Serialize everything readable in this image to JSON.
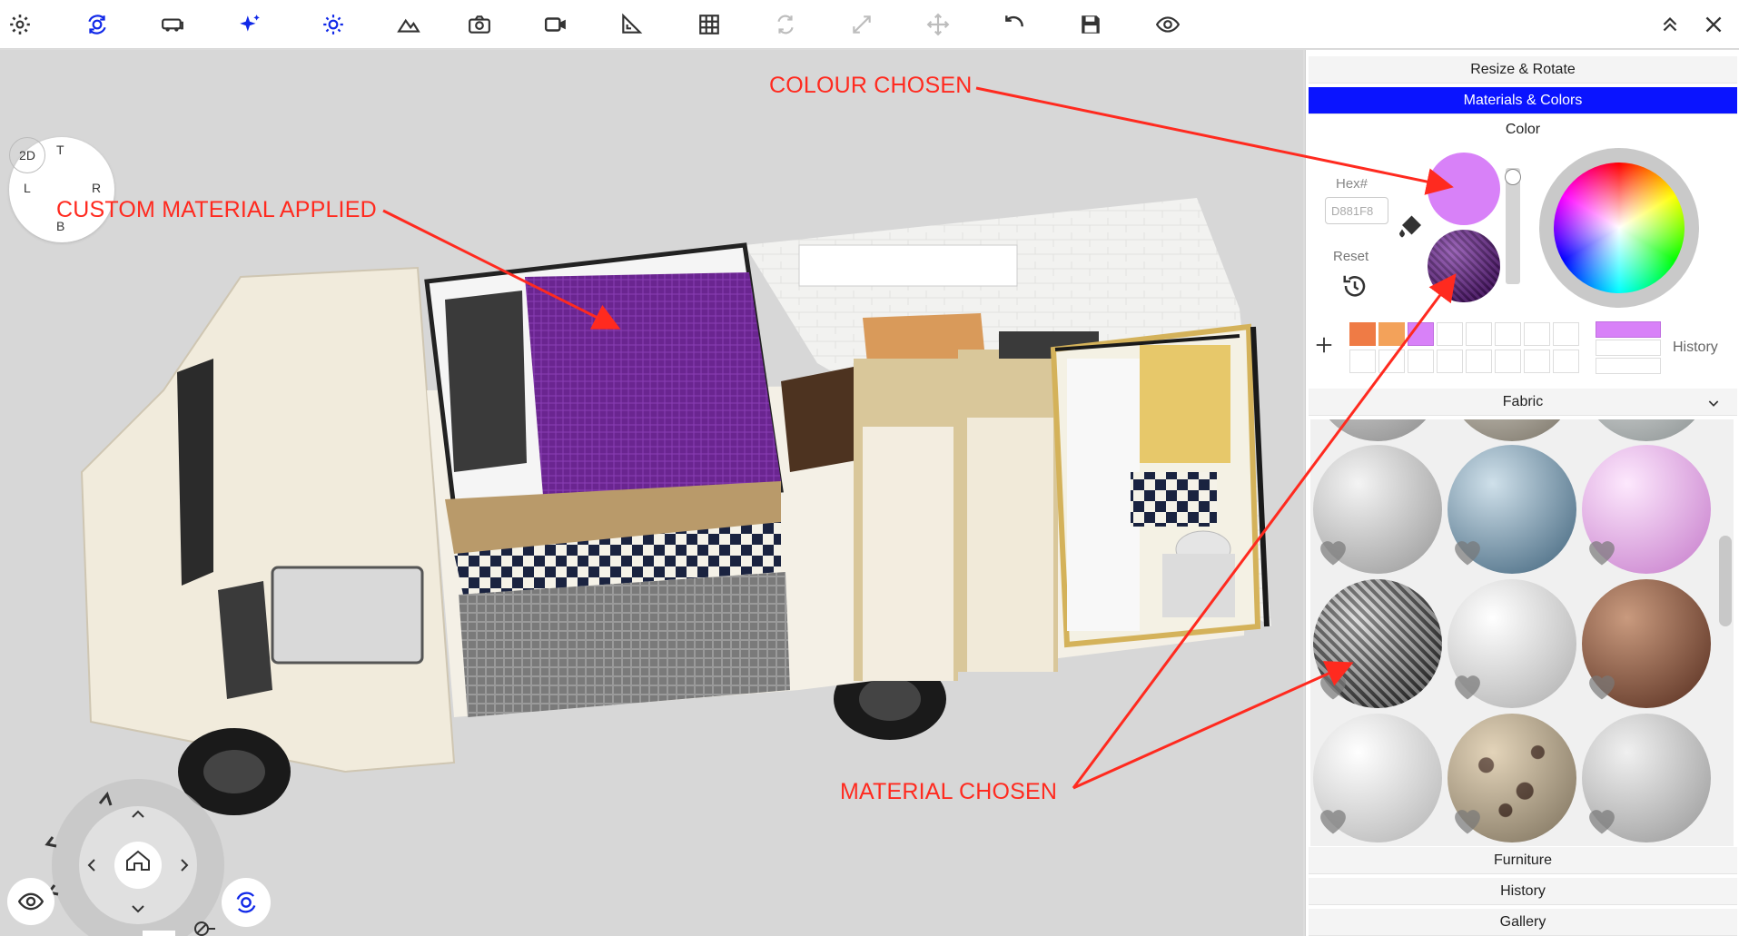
{
  "toolbar": {
    "icons": [
      "gear-icon",
      "orbit-icon",
      "van-icon",
      "sparkle-icon",
      "sun-icon",
      "mountain-icon",
      "camera-icon",
      "video-icon",
      "ruler-angle-icon",
      "grid-icon",
      "rotate-icon",
      "resize-icon",
      "move-icon",
      "undo-icon",
      "save-icon",
      "eye-icon",
      "collapse-icon",
      "close-icon"
    ]
  },
  "compass": {
    "top": "T",
    "left": "L",
    "center": "2D",
    "right": "R",
    "bottom": "B"
  },
  "annotations": {
    "colour": "COLOUR CHOSEN",
    "custom": "CUSTOM MATERIAL APPLIED",
    "material": "MATERIAL CHOSEN"
  },
  "panel": {
    "resize_rotate": "Resize & Rotate",
    "materials_colors": "Materials & Colors",
    "color": "Color",
    "hex_label": "Hex#",
    "hex_value": "D881F8",
    "reset": "Reset",
    "history_label": "History",
    "fabric": "Fabric",
    "furniture": "Furniture",
    "history": "History",
    "gallery": "Gallery"
  },
  "colors": {
    "chosen": "#d881f8",
    "accent": "#0a14ff",
    "annotation": "#ff2a1f",
    "palette": [
      "#ef7b45",
      "#f3a25a",
      "#d881f8"
    ]
  }
}
